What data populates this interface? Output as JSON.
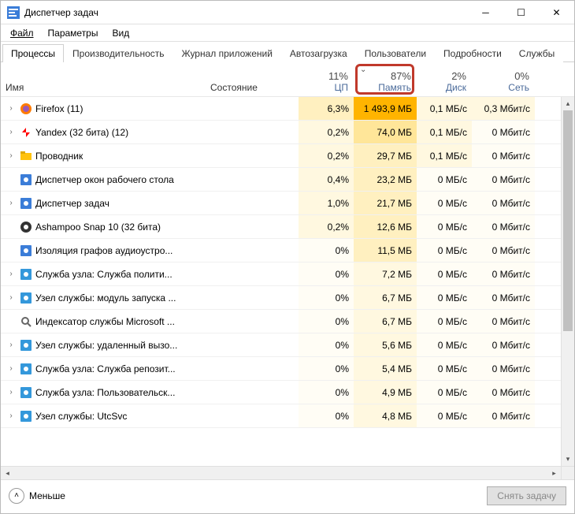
{
  "window": {
    "title": "Диспетчер задач"
  },
  "menu": {
    "file": "Файл",
    "options": "Параметры",
    "view": "Вид"
  },
  "tabs": {
    "processes": "Процессы",
    "performance": "Производительность",
    "app_history": "Журнал приложений",
    "startup": "Автозагрузка",
    "users": "Пользователи",
    "details": "Подробности",
    "services": "Службы"
  },
  "columns": {
    "name": "Имя",
    "status": "Состояние",
    "cpu_pct": "11%",
    "cpu_label": "ЦП",
    "mem_pct": "87%",
    "mem_label": "Память",
    "disk_pct": "2%",
    "disk_label": "Диск",
    "net_pct": "0%",
    "net_label": "Сеть"
  },
  "footer": {
    "fewer": "Меньше",
    "end_task": "Снять задачу"
  },
  "icons": {
    "firefox": "#ff7b00",
    "yandex": "#ff0000",
    "explorer": "#ffc20e",
    "dwm": "#3b7dd8",
    "taskmgr": "#3b7dd8",
    "snap": "#9b59b6",
    "audio": "#3b7dd8",
    "gear": "#3498db",
    "indexer": "#95a5a6"
  },
  "rows": [
    {
      "exp": true,
      "icon": "firefox",
      "name": "Firefox (11)",
      "cpu": "6,3%",
      "cpuH": "h2",
      "mem": "1 493,9 МБ",
      "memH": "h6",
      "disk": "0,1 МБ/с",
      "diskH": "h1",
      "net": "0,3 Мбит/с",
      "netH": "h1"
    },
    {
      "exp": true,
      "icon": "yandex",
      "name": "Yandex (32 бита) (12)",
      "cpu": "0,2%",
      "cpuH": "h1",
      "mem": "74,0 МБ",
      "memH": "h3",
      "disk": "0,1 МБ/с",
      "diskH": "h1",
      "net": "0 Мбит/с",
      "netH": "h0"
    },
    {
      "exp": true,
      "icon": "explorer",
      "name": "Проводник",
      "cpu": "0,2%",
      "cpuH": "h1",
      "mem": "29,7 МБ",
      "memH": "h2",
      "disk": "0,1 МБ/с",
      "diskH": "h1",
      "net": "0 Мбит/с",
      "netH": "h0"
    },
    {
      "exp": false,
      "icon": "dwm",
      "name": "Диспетчер окон рабочего стола",
      "cpu": "0,4%",
      "cpuH": "h1",
      "mem": "23,2 МБ",
      "memH": "h2",
      "disk": "0 МБ/с",
      "diskH": "h0",
      "net": "0 Мбит/с",
      "netH": "h0"
    },
    {
      "exp": true,
      "icon": "taskmgr",
      "name": "Диспетчер задач",
      "cpu": "1,0%",
      "cpuH": "h1",
      "mem": "21,7 МБ",
      "memH": "h2",
      "disk": "0 МБ/с",
      "diskH": "h0",
      "net": "0 Мбит/с",
      "netH": "h0"
    },
    {
      "exp": false,
      "icon": "snap",
      "name": "Ashampoo Snap 10 (32 бита)",
      "cpu": "0,2%",
      "cpuH": "h1",
      "mem": "12,6 МБ",
      "memH": "h2",
      "disk": "0 МБ/с",
      "diskH": "h0",
      "net": "0 Мбит/с",
      "netH": "h0"
    },
    {
      "exp": false,
      "icon": "audio",
      "name": "Изоляция графов аудиоустро...",
      "cpu": "0%",
      "cpuH": "h0",
      "mem": "11,5 МБ",
      "memH": "h2",
      "disk": "0 МБ/с",
      "diskH": "h0",
      "net": "0 Мбит/с",
      "netH": "h0"
    },
    {
      "exp": true,
      "icon": "gear",
      "name": "Служба узла: Служба полити...",
      "cpu": "0%",
      "cpuH": "h0",
      "mem": "7,2 МБ",
      "memH": "h1",
      "disk": "0 МБ/с",
      "diskH": "h0",
      "net": "0 Мбит/с",
      "netH": "h0"
    },
    {
      "exp": true,
      "icon": "gear",
      "name": "Узел службы: модуль запуска ...",
      "cpu": "0%",
      "cpuH": "h0",
      "mem": "6,7 МБ",
      "memH": "h1",
      "disk": "0 МБ/с",
      "diskH": "h0",
      "net": "0 Мбит/с",
      "netH": "h0"
    },
    {
      "exp": false,
      "icon": "indexer",
      "name": "Индексатор службы Microsoft ...",
      "cpu": "0%",
      "cpuH": "h0",
      "mem": "6,7 МБ",
      "memH": "h1",
      "disk": "0 МБ/с",
      "diskH": "h0",
      "net": "0 Мбит/с",
      "netH": "h0"
    },
    {
      "exp": true,
      "icon": "gear",
      "name": "Узел службы: удаленный вызо...",
      "cpu": "0%",
      "cpuH": "h0",
      "mem": "5,6 МБ",
      "memH": "h1",
      "disk": "0 МБ/с",
      "diskH": "h0",
      "net": "0 Мбит/с",
      "netH": "h0"
    },
    {
      "exp": true,
      "icon": "gear",
      "name": "Служба узла: Служба репозит...",
      "cpu": "0%",
      "cpuH": "h0",
      "mem": "5,4 МБ",
      "memH": "h1",
      "disk": "0 МБ/с",
      "diskH": "h0",
      "net": "0 Мбит/с",
      "netH": "h0"
    },
    {
      "exp": true,
      "icon": "gear",
      "name": "Служба узла: Пользовательск...",
      "cpu": "0%",
      "cpuH": "h0",
      "mem": "4,9 МБ",
      "memH": "h1",
      "disk": "0 МБ/с",
      "diskH": "h0",
      "net": "0 Мбит/с",
      "netH": "h0"
    },
    {
      "exp": true,
      "icon": "gear",
      "name": "Узел службы: UtcSvc",
      "cpu": "0%",
      "cpuH": "h0",
      "mem": "4,8 МБ",
      "memH": "h1",
      "disk": "0 МБ/с",
      "diskH": "h0",
      "net": "0 Мбит/с",
      "netH": "h0"
    }
  ]
}
